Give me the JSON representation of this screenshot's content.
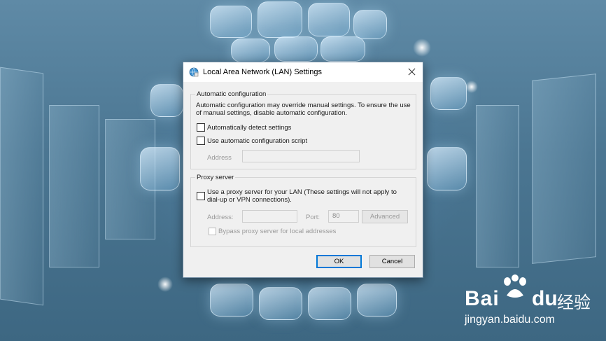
{
  "dialog": {
    "title": "Local Area Network (LAN) Settings",
    "auto_config": {
      "legend": "Automatic configuration",
      "description": "Automatic configuration may override manual settings.  To ensure the use of manual settings, disable automatic configuration.",
      "detect_label": "Automatically detect settings",
      "detect_checked": false,
      "script_label": "Use automatic configuration script",
      "script_checked": false,
      "address_label": "Address",
      "address_value": ""
    },
    "proxy": {
      "legend": "Proxy server",
      "use_proxy_label_line1": "Use a proxy server for your LAN (These settings will not apply to",
      "use_proxy_label_line2": "dial-up or VPN connections).",
      "use_proxy_checked": false,
      "address_label": "Address:",
      "address_value": "",
      "port_label": "Port:",
      "port_value": "80",
      "advanced_label": "Advanced",
      "bypass_label": "Bypass proxy server for local addresses",
      "bypass_checked": false
    },
    "buttons": {
      "ok": "OK",
      "cancel": "Cancel"
    }
  },
  "watermark": {
    "brand_bai": "Bai",
    "brand_du": "du",
    "brand_jingyan": "经验",
    "url": "jingyan.baidu.com"
  },
  "icons": [
    "network-globe-icon",
    "close-icon",
    "baidu-paw-icon"
  ]
}
